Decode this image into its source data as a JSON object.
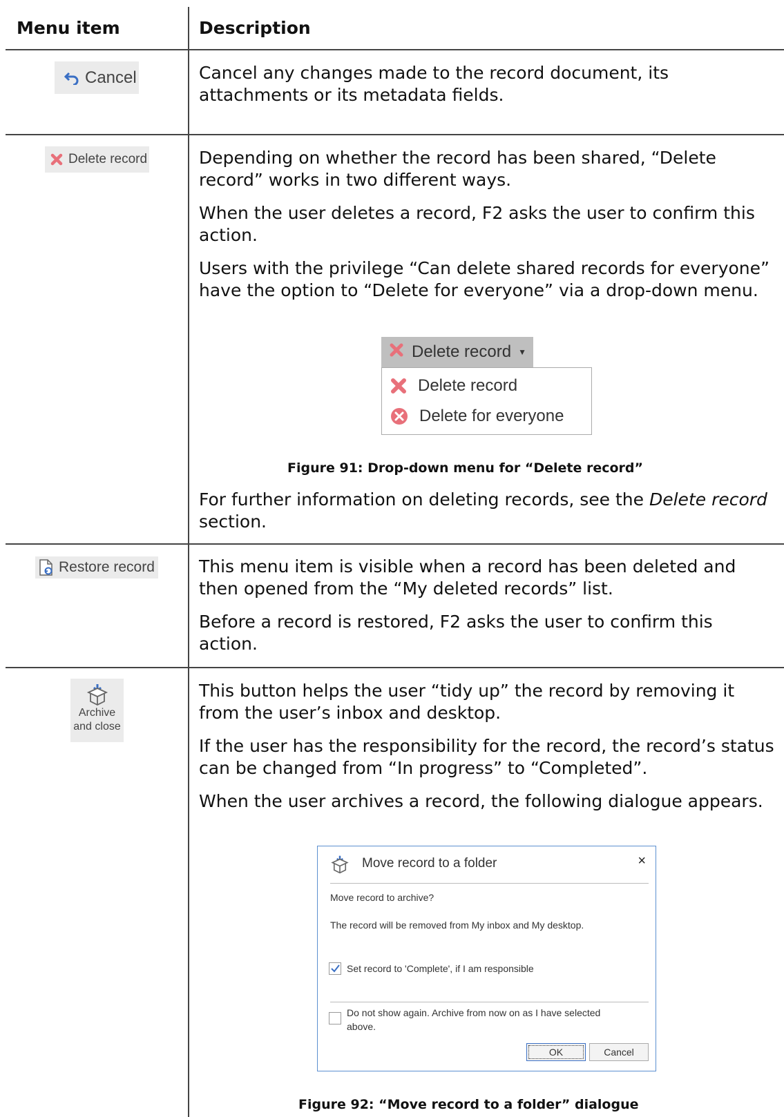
{
  "header": {
    "menu_item": "Menu item",
    "description": "Description"
  },
  "rows": {
    "cancel": {
      "button_label": "Cancel",
      "text": "Cancel any changes made to the record document, its attachments or its metadata fields."
    },
    "delete": {
      "button_label": "Delete record",
      "p1": "Depending on whether the record has been shared, “Delete record” works in two different ways.",
      "p2": "When the user deletes a record, F2 asks the user to confirm this action.",
      "p3": "Users with the privilege “Can delete shared records for everyone” have the option to “Delete for everyone” via a drop-down menu.",
      "dropdown": {
        "button": "Delete record",
        "item1": "Delete record",
        "item2": "Delete for everyone"
      },
      "caption": "Figure 91: Drop-down menu for “Delete record”",
      "p4_pre": "For further information on deleting records, see the ",
      "p4_em": "Delete record",
      "p4_post": " section."
    },
    "restore": {
      "button_label": "Restore record",
      "p1": "This menu item is visible when a record has been deleted and then opened from the “My deleted records” list.",
      "p2": "Before a record is restored, F2 asks the user to confirm this action."
    },
    "archive": {
      "button_line1": "Archive",
      "button_line2": "and close",
      "p1": "This button helps the user “tidy up” the record by removing it from the user’s inbox and desktop.",
      "p2": "If the user has the responsibility for the record, the record’s status can be changed from “In progress” to “Completed”.",
      "p3": "When the user archives a record, the following dialogue appears.",
      "dialog": {
        "title": "Move record to a folder",
        "close": "×",
        "question": "Move record to archive?",
        "info": "The record will be removed from My inbox and My desktop.",
        "checkbox1": "Set record to 'Complete', if I am responsible",
        "checkbox1_checked": true,
        "checkbox2_line1": "Do not show again. Archive from now on as I have selected",
        "checkbox2_line2": "above.",
        "checkbox2_checked": false,
        "ok": "OK",
        "cancel": "Cancel"
      },
      "caption": "Figure 92: “Move record to a folder” dialogue"
    }
  },
  "colors": {
    "accent": "#3a6fc4",
    "delete_red": "#e8707a",
    "dialog_border": "#5b8fd0"
  }
}
